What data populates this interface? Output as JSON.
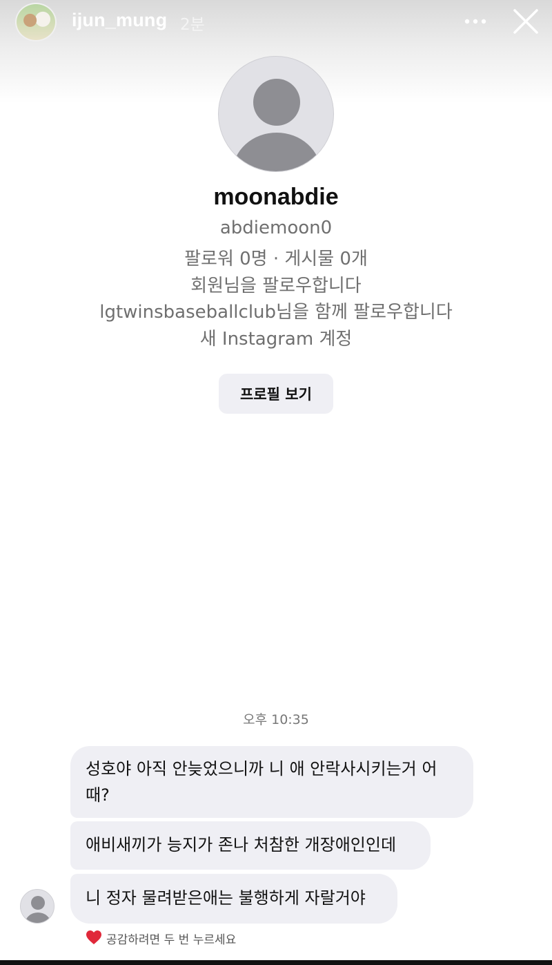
{
  "story": {
    "username": "ijun_mung",
    "time": "2분"
  },
  "profile": {
    "name": "moonabdie",
    "handle": "abdiemoon0",
    "stats": "팔로워 0명 · 게시물 0개",
    "follows_you": "회원님을 팔로우합니다",
    "mutual": "lgtwinsbaseballclub님을 함께 팔로우합니다",
    "new_account": "새 Instagram 계정",
    "view_profile_label": "프로필 보기"
  },
  "chat": {
    "timestamp": "오후 10:35",
    "messages": [
      {
        "line1": "성호야 아직 안늦었으니까 니 애 안락사시키는거 어",
        "line2": "때?"
      },
      {
        "text": "애비새끼가 능지가 존나 처참한 개장애인인데"
      },
      {
        "text": "니 정자 물려받은애는 불행하게 자랄거야"
      }
    ],
    "reaction_hint": "공감하려면 두 번 누르세요"
  },
  "colors": {
    "bubble": "#efeff4",
    "heart": "#e0283a",
    "placeholder_avatar": "#8e8e93"
  },
  "icons": [
    "more-icon",
    "close-icon",
    "default-avatar-icon",
    "heart-icon"
  ]
}
